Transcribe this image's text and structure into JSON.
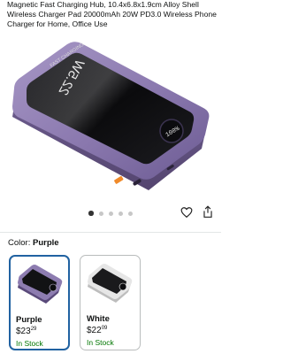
{
  "product": {
    "title": "Magnetic Fast Charging Hub, 10.4x6.8x1.9cm Alloy Shell Wireless Charger Pad 20000mAh 20W PD3.0 Wireless Phone Charger for Home, Office Use",
    "device_text": {
      "banner": "FAST CHARGING",
      "logo": "22.5W",
      "display": "100%"
    }
  },
  "gallery": {
    "image_count": 5,
    "active_index": 0
  },
  "actions": {
    "favorite_icon": "heart-icon",
    "share_icon": "share-icon"
  },
  "color_selector": {
    "label": "Color:",
    "selected": "Purple",
    "options": [
      {
        "name": "Purple",
        "price_whole": "$23",
        "price_fraction": "29",
        "stock": "In Stock",
        "selected": true
      },
      {
        "name": "White",
        "price_whole": "$22",
        "price_fraction": "09",
        "stock": "In Stock",
        "selected": false
      }
    ]
  },
  "colors": {
    "accent": "#2162a1",
    "stock": "#007600",
    "product_purple": "#8d7cb0",
    "product_white": "#e6e6e6"
  }
}
